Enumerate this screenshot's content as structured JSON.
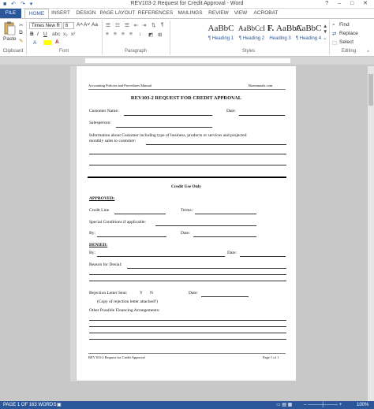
{
  "window": {
    "title": "REV103-2 Request for Credit Approval - Word",
    "quick_access": "■ ↶ ↷ ▾",
    "controls": "? – □ ✕"
  },
  "tabs": [
    "FILE",
    "HOME",
    "INSERT",
    "DESIGN",
    "PAGE LAYOUT",
    "REFERENCES",
    "MAILINGS",
    "REVIEW",
    "VIEW",
    "ACROBAT"
  ],
  "ribbon": {
    "clipboard": {
      "paste_label": "Paste",
      "group_label": "Clipboard"
    },
    "font": {
      "font_name": "Times New R",
      "font_size": "6",
      "bold": "B",
      "italic": "I",
      "underline": "U",
      "group_label": "Font",
      "grow": "A˄",
      "shrink": "A˅",
      "case": "Aa",
      "color": "A"
    },
    "paragraph": {
      "group_label": "Paragraph"
    },
    "styles": {
      "group_label": "Styles",
      "items": [
        {
          "sample": "AaBbC",
          "name": "¶ Heading 1"
        },
        {
          "sample": "AaBbCcI",
          "name": "¶ Heading 2"
        },
        {
          "sample": "F.",
          "name": "AaBbC"
        },
        {
          "sample": "AaBbC",
          "name": "Heading 3"
        },
        {
          "sample": "AaBbC",
          "name": "¶ Heading 4"
        }
      ]
    },
    "editing": {
      "find": "Find",
      "replace": "Replace",
      "select": "Select",
      "group_label": "Editing"
    }
  },
  "document": {
    "header_left": "Accounting Policies and Procedures Manual",
    "header_right": "Bizmanualz.com",
    "title": "REV103-2 REQUEST FOR CREDIT APPROVAL",
    "customer_name": "Customer Name:",
    "date": "Date:",
    "salesperson": "Salesperson:",
    "info_line1": "Information about Customer including type of business, products or services and projected",
    "info_line2": "monthly sales to customer:",
    "credit_use_only": "Credit Use Only",
    "approved": "APPROVED:",
    "credit_line": "Credit Line",
    "terms": "Terms:",
    "special_conditions": "Special Conditions if applicable:",
    "by": "By:",
    "denied": "DENIED:",
    "reason_for_denial": "Reason for Denial:",
    "rejection_letter_sent": "Rejection Letter Sent:",
    "yes": "Y",
    "no": "N",
    "copy_note": "(Copy of rejection letter attached?)",
    "other_financing": "Other Possible Financing Arrangements:",
    "footer_left": "REV103-2 Request for Credit Approval",
    "footer_right": "Page 1 of 1"
  },
  "status": {
    "page": "PAGE 1 OF 1",
    "words": "63 WORDS",
    "zoom": "100%"
  }
}
